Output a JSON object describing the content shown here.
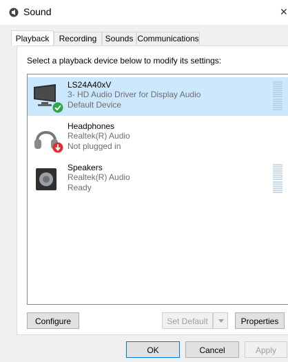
{
  "window": {
    "title": "Sound",
    "icon": "speaker-icon",
    "close_glyph": "✕"
  },
  "tabs": [
    {
      "label": "Playback",
      "active": true
    },
    {
      "label": "Recording",
      "active": false
    },
    {
      "label": "Sounds",
      "active": false
    },
    {
      "label": "Communications",
      "active": false
    }
  ],
  "instruction": "Select a playback device below to modify its settings:",
  "devices": [
    {
      "name": "LS24A40xV",
      "line2": "3- HD Audio Driver for Display Audio",
      "line3": "Default Device",
      "icon": "monitor-icon",
      "badge": "default-check-icon",
      "selected": true
    },
    {
      "name": "Headphones",
      "line2": "Realtek(R) Audio",
      "line3": "Not plugged in",
      "icon": "headphones-icon",
      "badge": "unplugged-icon",
      "selected": false
    },
    {
      "name": "Speakers",
      "line2": "Realtek(R) Audio",
      "line3": "Ready",
      "icon": "speaker-box-icon",
      "badge": "",
      "selected": false
    }
  ],
  "buttons": {
    "configure": "Configure",
    "set_default": "Set Default",
    "properties": "Properties",
    "ok": "OK",
    "cancel": "Cancel",
    "apply": "Apply"
  },
  "colors": {
    "selection": "#cce8ff",
    "accent": "#0078d7",
    "check": "#2aa844",
    "unplugged": "#d9312b"
  }
}
